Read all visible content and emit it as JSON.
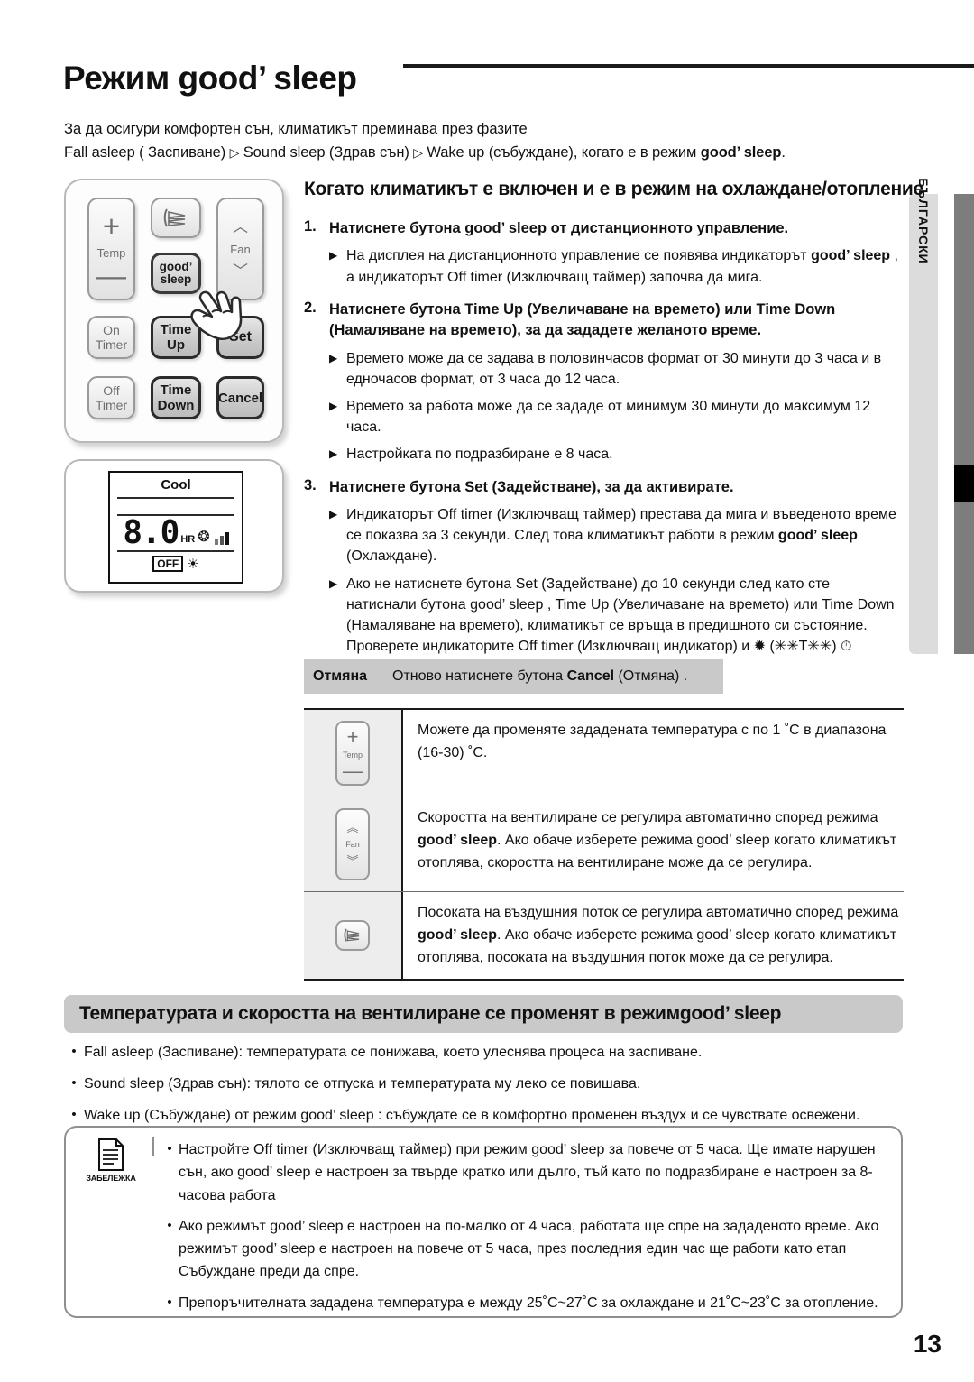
{
  "page": {
    "title_prefix": "Режим ",
    "title_brand": "good’ sleep",
    "number": "13",
    "language_tab": "БЪЛГАРСКИ"
  },
  "intro": {
    "line1": "За да осигури комфортен сън, климатикът преминава през фазите",
    "line2_a": "Fall asleep ( Заспиване) ",
    "line2_tri1": "▷",
    "line2_b": " Sound sleep (Здрав сън) ",
    "line2_tri2": "▷",
    "line2_c": " Wake up (събуждане), когато е в режим ",
    "line2_brand": "good’ sleep",
    "line2_d": "."
  },
  "remote": {
    "temp_plus": "+",
    "temp_label": "Temp",
    "temp_minus": "—",
    "swing_icon": "swing-icon",
    "fan_up": "︿",
    "fan_label": "Fan",
    "fan_down": "﹀",
    "good_sleep_l1": "good’",
    "good_sleep_l2": "sleep",
    "on_timer_l1": "On",
    "on_timer_l2": "Timer",
    "time_up_l1": "Time",
    "time_up_l2": "Up",
    "set": "Set",
    "off_timer_l1": "Off",
    "off_timer_l2": "Timer",
    "time_down_l1": "Time",
    "time_down_l2": "Down",
    "cancel": "Cancel"
  },
  "lcd": {
    "mode": "Cool",
    "value": "8.0",
    "unit": "HR",
    "fan_icon": "fan-icon",
    "off_badge": "OFF",
    "sleep_icon": "good-sleep-icon"
  },
  "section1": {
    "heading": "Когато климатикът е включен и е в режим на охлаждане/отопление",
    "steps": [
      {
        "num": "1.",
        "head_a": "Натиснете бутона ",
        "head_brand": "good’ sleep",
        "head_b": " от дистанционното управление.",
        "subs": [
          {
            "a": "На дисплея на дистанционното управление се появява индикаторът ",
            "brand": "good’ sleep",
            "b": " , а индикаторът Off timer (Изключващ таймер) започва да мига."
          }
        ]
      },
      {
        "num": "2.",
        "head_a": "Натиснете бутона Time Up (Увеличаване на времето) или Time Down (Намаляване на времето), за да зададете желаното време.",
        "head_brand": "",
        "head_b": "",
        "subs": [
          {
            "a": "Времето може да се задава в половинчасов формат от 30 минути до 3 часа и в едночасов формат, от 3 часа до 12 часа.",
            "brand": "",
            "b": ""
          },
          {
            "a": "Времето за работа може да се зададе от минимум 30 минути до максимум 12 часа.",
            "brand": "",
            "b": ""
          },
          {
            "a": "Настройката по подразбиране е 8 часа.",
            "brand": "",
            "b": ""
          }
        ]
      },
      {
        "num": "3.",
        "head_a": "Натиснете бутона Set (Задействане), за да активирате.",
        "head_brand": "",
        "head_b": "",
        "subs": [
          {
            "a": "Индикаторът Off timer (Изключващ таймер) престава да мига и въведеното време се показва за 3 секунди. След това климатикът работи в режим ",
            "brand": "good’ sleep",
            "b": " (Охлаждане)."
          },
          {
            "a": "Ако не натиснете бутона Set (Задействане) до 10 секунди след като сте натиснали бутона good’ sleep , Time Up (Увеличаване на времето) или Time Down (Намаляване на времето), климатикът се връща в предишното си състояние. Проверете индикаторите Off timer (Изключващ индикатор) и ✹ (✳✳T✳✳) ⏱ (✳✳U✳✳) на вътрешното тяло.",
            "brand": "",
            "b": ""
          }
        ]
      }
    ]
  },
  "cancel_row": {
    "key": "Отмяна",
    "value_a": "Отново натиснете бутона ",
    "value_b": "Cancel",
    "value_c": " (Отмяна) ."
  },
  "feature_table": {
    "rows": [
      {
        "icon": "temp-button-icon",
        "text_a": "Можете да променяте зададената температура с по 1 ˚C в диапазона (16-30) ˚C.",
        "text_b": "",
        "text_c": ""
      },
      {
        "icon": "fan-button-icon",
        "text_a": "Скоростта на вентилиране се регулира автоматично според режима ",
        "text_b": "good’ sleep",
        "text_c": ". Ако обаче изберете режима good’ sleep когато климатикът отоплява, скоростта на вентилиране може да се регулира."
      },
      {
        "icon": "swing-button-icon",
        "text_a": "Посоката на въздушния поток се регулира автоматично според режима ",
        "text_b": "good’ sleep",
        "text_c": ". Ако обаче изберете режима good’ sleep когато климатикът отоплява, посоката на въздушния поток може да се регулира."
      }
    ]
  },
  "section2": {
    "band_a": "Температурата и скоростта на вентилиране се променят в режим ",
    "band_brand": "good’ sleep",
    "bullets": [
      {
        "text": "Fall asleep (Заспиване): температурата се понижава, което улеснява процеса на заспиване."
      },
      {
        "text": "Sound sleep (Здрав сън): тялото се отпуска и температурата му леко се повишава."
      },
      {
        "text": "Wake up (Събуждане) от режим good’ sleep : събуждате се в комфортно променен въздух и се чувствате освежени."
      }
    ]
  },
  "note": {
    "caption": "ЗАБЕЛЕЖКА",
    "items": [
      {
        "text": "Настройте Off timer (Изключващ таймер) при режим good’ sleep за повече от 5 часа. Ще имате нарушен сън, ако good’ sleep е настроен за твърде кратко или дълго, тъй като по подразбиране е настроен за 8-часова работа"
      },
      {
        "text": "Ако режимът good’ sleep е настроен на по-малко от 4 часа, работата ще спре на зададеното време. Ако режимът good’ sleep е настроен на повече от 5 часа, през последния един час ще работи като етап Събуждане преди да спре."
      },
      {
        "text": "Препоръчителната зададена температура е между 25˚C~27˚C за охлаждане и 21˚C~23˚C за отопление."
      }
    ]
  }
}
